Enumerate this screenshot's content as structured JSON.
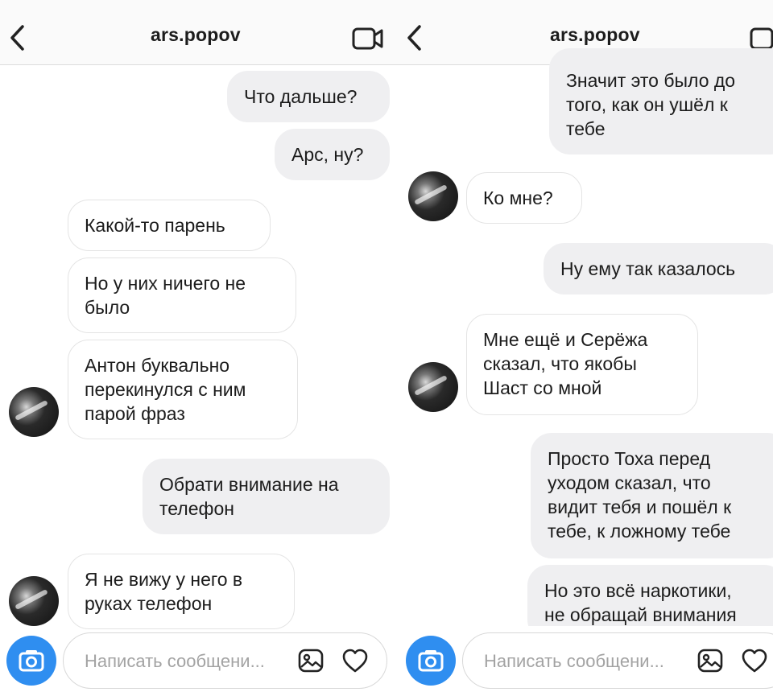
{
  "left": {
    "header": {
      "title": "ars.popov"
    },
    "messages": [
      {
        "text": "Что дальше?",
        "side": "out"
      },
      {
        "text": "Арс, ну?",
        "side": "out"
      },
      {
        "text": "Какой-то парень",
        "side": "in"
      },
      {
        "text": "Но у них ничего не\nбыло",
        "side": "in"
      },
      {
        "text": "Антон буквально\nперекинулся с ним\nпарой фраз",
        "side": "in"
      },
      {
        "text": "Обрати внимание на\nтелефон",
        "side": "out"
      },
      {
        "text": "Я не вижу у него в\nруках телефон",
        "side": "in"
      }
    ],
    "composer": {
      "placeholder": "Написать сообщени..."
    }
  },
  "right": {
    "header": {
      "title": "ars.popov"
    },
    "messages": [
      {
        "text": "Значит это было до\nтого, как он ушёл к\nтебе",
        "side": "out"
      },
      {
        "text": "Ко мне?",
        "side": "in"
      },
      {
        "text": "Ну ему так казалось",
        "side": "out"
      },
      {
        "text": "Мне ещё и Серёжа\nсказал, что якобы\nШаст со мной",
        "side": "in"
      },
      {
        "text": "Просто Тоха перед\nуходом сказал, что\nвидит тебя и пошёл к\nтебе, к ложному тебе",
        "side": "out"
      },
      {
        "text": "Но это всё наркотики,\nне обращай внимания",
        "side": "out"
      }
    ],
    "composer": {
      "placeholder": "Написать сообщени..."
    }
  },
  "colors": {
    "camera_button": "#2f8ef0",
    "outgoing_bubble": "#efeff1",
    "incoming_border": "#e4e4e4"
  },
  "icons": [
    "back-chevron-icon",
    "video-call-icon",
    "camera-icon",
    "gallery-icon",
    "heart-icon"
  ]
}
